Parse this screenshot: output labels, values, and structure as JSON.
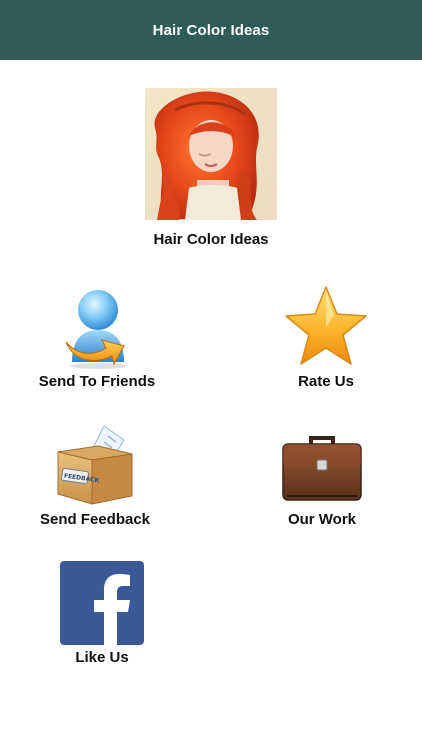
{
  "header": {
    "title": "Hair Color Ideas",
    "bar_color": "#2f5c56"
  },
  "hero": {
    "caption": "Hair Color Ideas",
    "image_icon": "red-haired-woman-photo"
  },
  "menu": {
    "items": [
      {
        "label": "Send To Friends",
        "icon": "person-share-icon"
      },
      {
        "label": "Rate Us",
        "icon": "star-icon"
      },
      {
        "label": "Send Feedback",
        "icon": "feedback-box-icon"
      },
      {
        "label": "Our Work",
        "icon": "briefcase-icon"
      },
      {
        "label": "Like Us",
        "icon": "facebook-icon"
      }
    ]
  },
  "colors": {
    "facebook_blue": "#3b5998",
    "star_gold": "#f7a11c"
  }
}
